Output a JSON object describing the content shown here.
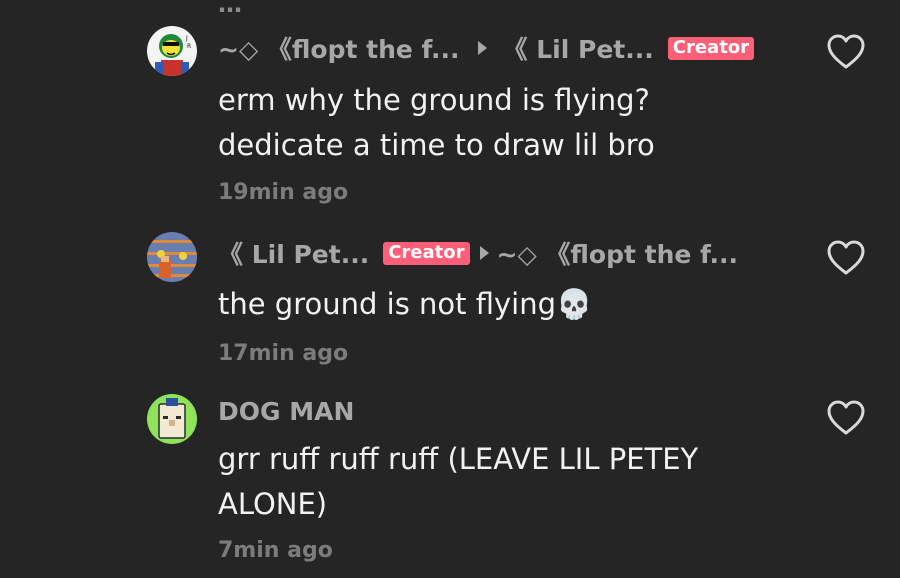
{
  "top_clipped_text": "…",
  "comments": [
    {
      "author": "~◇ 《flopt the f...",
      "reply_to": "《 Lil Pet...",
      "reply_to_badge": "Creator",
      "lines": [
        "erm why the ground is flying?",
        "dedicate a time to draw lil bro"
      ],
      "time": "19min ago",
      "avatar_icon": "cartoon-character-avatar-icon",
      "like_icon": "heart-outline-icon"
    },
    {
      "author": "《 Lil Pet...",
      "author_badge": "Creator",
      "reply_to": "~◇ 《flopt the f...",
      "lines": [
        "the ground is not flying💀"
      ],
      "time": "17min ago",
      "avatar_icon": "pixel-art-avatar-icon",
      "like_icon": "heart-outline-icon"
    },
    {
      "author": "DOG MAN",
      "lines": [
        "grr ruff ruff ruff (LEAVE LIL PETEY",
        "ALONE)"
      ],
      "time": "7min ago",
      "avatar_icon": "dog-man-avatar-icon",
      "like_icon": "heart-outline-icon"
    }
  ],
  "colors": {
    "background": "#252525",
    "creator_badge": "#fe5e77",
    "body_text": "#f2f2f2",
    "meta_text": "#a7a7a7",
    "time_text": "#7c7c7c"
  }
}
